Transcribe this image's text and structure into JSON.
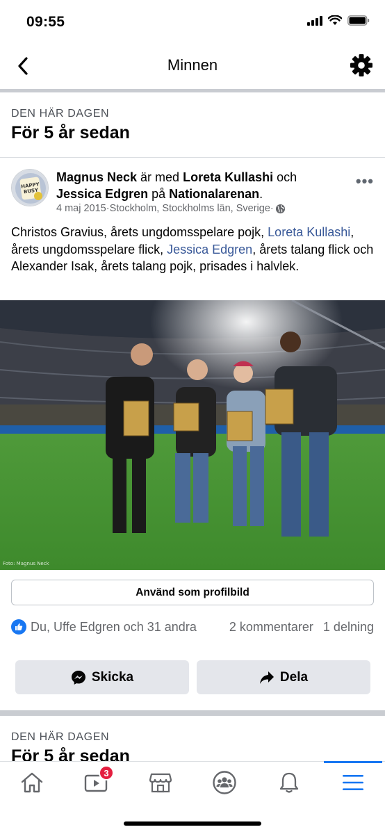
{
  "status": {
    "time": "09:55"
  },
  "nav": {
    "title": "Minnen"
  },
  "memory": {
    "kicker": "DEN HÄR DAGEN",
    "title": "För 5 år sedan",
    "post": {
      "author": "Magnus Neck",
      "with_word": " är med ",
      "tag1": "Loreta Kullashi",
      "and_word": " och ",
      "tag2": "Jessica Edgren",
      "at_word": " på ",
      "place": "Nationalarenan",
      "period": ".",
      "date": "4 maj 2015",
      "sep": " · ",
      "location": "Stockholm, Stockholms län, Sverige",
      "sep2": " · ",
      "text_part1": "Christos Gravius, årets ungdomsspelare pojk, ",
      "text_link1": "Loreta Kullashi",
      "text_part2": ", årets ungdomsspelare flick, ",
      "text_link2": "Jessica Edgren",
      "text_part3": ", årets talang flick och Alexander Isak, årets talang pojk, prisades i halvlek.",
      "photo_credit": "Foto: Magnus Neck",
      "profile_button": "Använd som profilbild",
      "reactions": "Du, Uffe Edgren och 31 andra",
      "comments": "2 kommentarer",
      "shares": "1 delning",
      "send_label": "Skicka",
      "share_label": "Dela"
    }
  },
  "memory2": {
    "kicker": "DEN HÄR DAGEN",
    "title": "För 5 år sedan"
  },
  "tabs": {
    "watch_badge": "3"
  },
  "colors": {
    "accent": "#1877f2",
    "link": "#385898",
    "badge": "#e41e3f"
  }
}
